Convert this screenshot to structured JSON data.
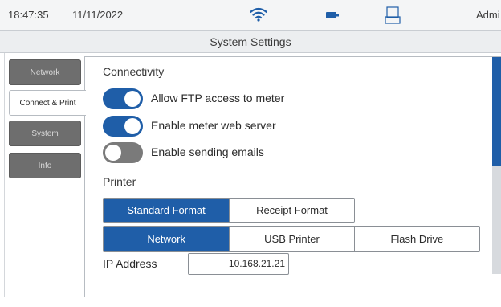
{
  "status_bar": {
    "time": "18:47:35",
    "date": "11/11/2022",
    "user": "Admi",
    "icons": [
      "wifi-icon",
      "battery-icon",
      "usb-drive-icon"
    ]
  },
  "title": "System Settings",
  "tabs": [
    {
      "label": "Network",
      "active": false
    },
    {
      "label": "Connect & Print",
      "active": true
    },
    {
      "label": "System",
      "active": false
    },
    {
      "label": "Info",
      "active": false
    }
  ],
  "connectivity": {
    "heading": "Connectivity",
    "toggles": [
      {
        "label": "Allow FTP access to meter",
        "on": true
      },
      {
        "label": "Enable meter web server",
        "on": true
      },
      {
        "label": "Enable sending emails",
        "on": false
      }
    ]
  },
  "printer": {
    "heading": "Printer",
    "format_options": [
      {
        "label": "Standard Format",
        "selected": true
      },
      {
        "label": "Receipt Format",
        "selected": false
      }
    ],
    "destination_options": [
      {
        "label": "Network",
        "selected": true
      },
      {
        "label": "USB Printer",
        "selected": false
      },
      {
        "label": "Flash Drive",
        "selected": false
      }
    ],
    "ip_label": "IP Address",
    "ip_value": "10.168.21.21"
  },
  "colors": {
    "accent": "#1f5ea8",
    "inactive_tab": "#6e6e6e",
    "toggle_off": "#7a7a7a"
  }
}
